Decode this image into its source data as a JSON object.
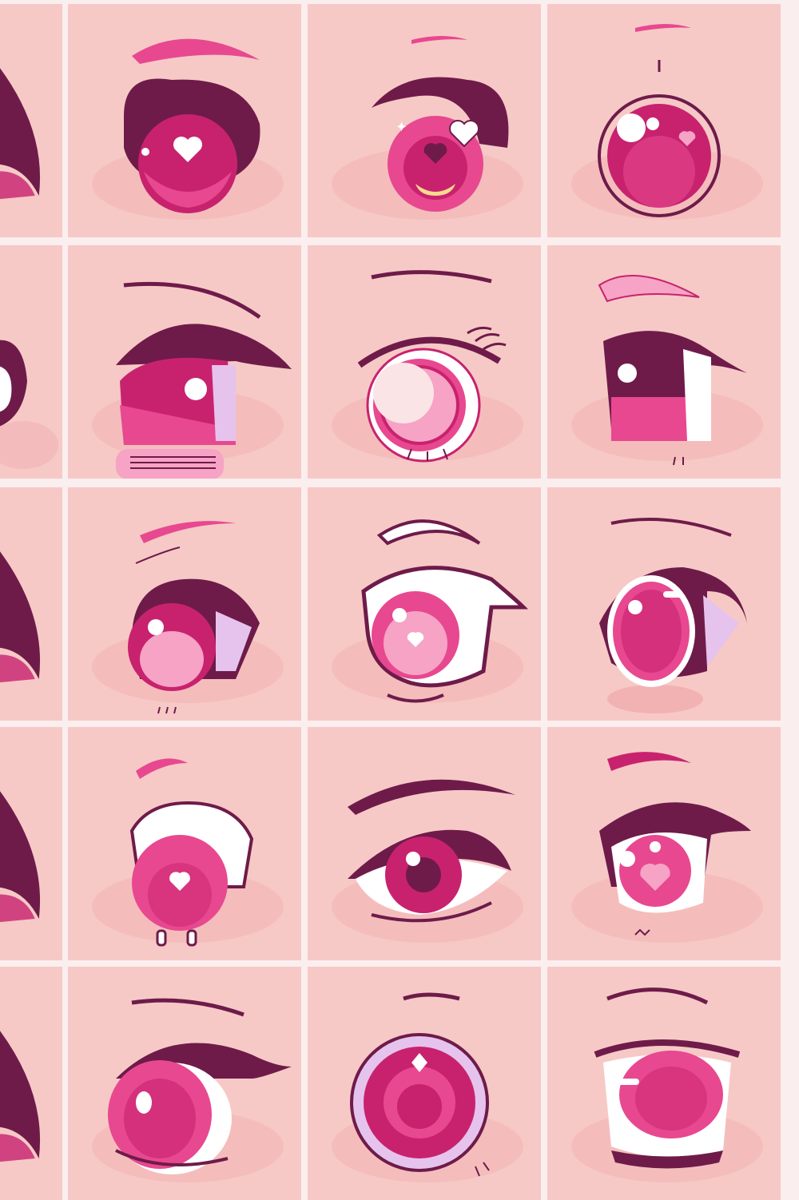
{
  "colors": {
    "background": "#fbeeee",
    "tile": "#f6c9c6",
    "shadow": "#f2b2b4",
    "plum": "#6e1b4a",
    "magenta": "#c8226e",
    "hot_pink": "#e8488f",
    "light_pink": "#f6a3c5",
    "lilac": "#e6c3ec",
    "white": "#ffffff"
  },
  "eyes": [
    {
      "row": 0,
      "col": 0,
      "variant": "edge-wing",
      "icon": "eye-partial-icon"
    },
    {
      "row": 0,
      "col": 1,
      "variant": "round-heart",
      "icon": "heart-eye-icon"
    },
    {
      "row": 0,
      "col": 2,
      "variant": "star-heart",
      "icon": "sparkle-heart-eye-icon"
    },
    {
      "row": 0,
      "col": 3,
      "variant": "galaxy-orb",
      "icon": "galaxy-eye-icon"
    },
    {
      "row": 1,
      "col": 0,
      "variant": "edge-round",
      "icon": "eye-partial-icon"
    },
    {
      "row": 1,
      "col": 1,
      "variant": "lidded-stripe",
      "icon": "lidded-eye-icon"
    },
    {
      "row": 1,
      "col": 2,
      "variant": "lashed-ring",
      "icon": "lashed-eye-icon"
    },
    {
      "row": 1,
      "col": 3,
      "variant": "side-glance",
      "icon": "side-eye-icon"
    },
    {
      "row": 2,
      "col": 0,
      "variant": "edge-wing",
      "icon": "eye-partial-icon"
    },
    {
      "row": 2,
      "col": 1,
      "variant": "gradient-iris",
      "icon": "gradient-eye-icon"
    },
    {
      "row": 2,
      "col": 2,
      "variant": "outlined-heart",
      "icon": "outlined-heart-eye-icon"
    },
    {
      "row": 2,
      "col": 3,
      "variant": "oval-glossy",
      "icon": "glossy-eye-icon"
    },
    {
      "row": 3,
      "col": 0,
      "variant": "edge-wing",
      "icon": "eye-partial-icon"
    },
    {
      "row": 3,
      "col": 1,
      "variant": "bun-heart",
      "icon": "bun-heart-eye-icon"
    },
    {
      "row": 3,
      "col": 2,
      "variant": "almond-realistic",
      "icon": "almond-eye-icon"
    },
    {
      "row": 3,
      "col": 3,
      "variant": "cute-heart-mouth",
      "icon": "cute-eye-icon"
    },
    {
      "row": 4,
      "col": 0,
      "variant": "edge-wing",
      "icon": "eye-partial-icon"
    },
    {
      "row": 4,
      "col": 1,
      "variant": "wide-oval",
      "icon": "wide-eye-icon"
    },
    {
      "row": 4,
      "col": 2,
      "variant": "diamond-ring",
      "icon": "diamond-eye-icon"
    },
    {
      "row": 4,
      "col": 3,
      "variant": "half-lidded",
      "icon": "sleepy-eye-icon"
    }
  ]
}
